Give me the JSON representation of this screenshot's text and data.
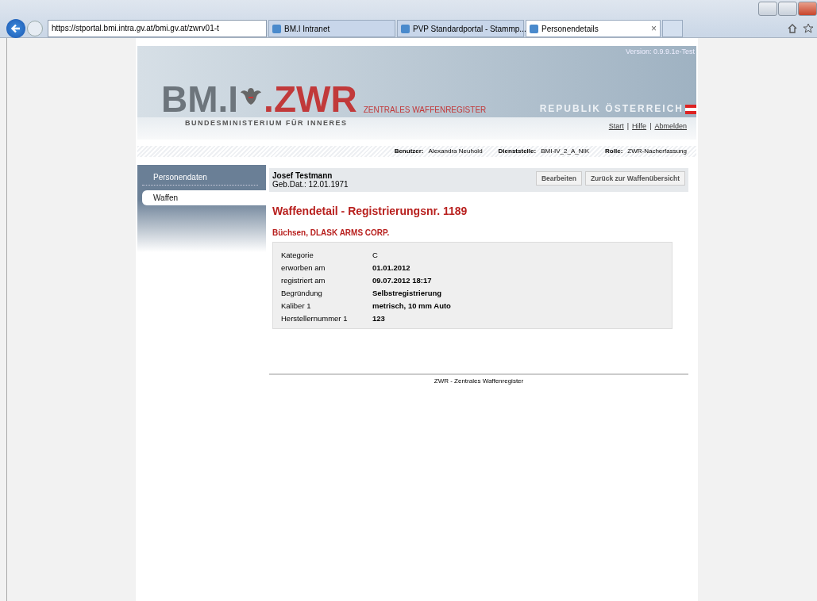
{
  "browser": {
    "address": "https://stportal.bmi.intra.gv.at/bmi.gv.at/zwrv01-t",
    "tabs": [
      {
        "label": "BM.I Intranet",
        "selected": false
      },
      {
        "label": "PVP Standardportal - Stammp...",
        "selected": false
      },
      {
        "label": "Personendetails",
        "selected": true
      }
    ],
    "close_glyph": "×"
  },
  "header": {
    "version": "Version: 0.9.9.1e-Test",
    "logo_left": "BM.I",
    "logo_right": ".ZWR",
    "subtitle": "ZENTRALES WAFFENREGISTER",
    "ministry": "BUNDESMINISTERIUM FÜR INNERES",
    "republic": "REPUBLIK ÖSTERREICH",
    "links": [
      "Start",
      "Hilfe",
      "Abmelden"
    ],
    "link_separator": "|"
  },
  "userbar": [
    {
      "label": "Benutzer:",
      "value": "Alexandra Neuhold"
    },
    {
      "label": "Dienststelle:",
      "value": "BMI-IV_2_A_NIK"
    },
    {
      "label": "Rolle:",
      "value": "ZWR-Nacherfassung"
    }
  ],
  "sidebar": {
    "items": [
      {
        "label": "Personendaten",
        "selected": false
      },
      {
        "label": "Waffen",
        "selected": true
      }
    ]
  },
  "person": {
    "name": "Josef Testmann",
    "birth": "Geb.Dat.: 12.01.1971",
    "buttons": [
      "Bearbeiten",
      "Zurück zur Waffenübersicht"
    ]
  },
  "title": "Waffendetail - Registrierungsnr. 1189",
  "subtitle": "Büchsen, DLASK ARMS CORP.",
  "details": [
    {
      "label": "Kategorie",
      "value": "C",
      "bold": false
    },
    {
      "label": "erworben am",
      "value": "01.01.2012",
      "bold": true
    },
    {
      "label": "registriert am",
      "value": "09.07.2012 18:17",
      "bold": true
    },
    {
      "label": "Begründung",
      "value": "Selbstregistrierung",
      "bold": true
    },
    {
      "label": "Kaliber 1",
      "value": "metrisch, 10 mm Auto",
      "bold": true
    },
    {
      "label": "Herstellernummer 1",
      "value": "123",
      "bold": true
    }
  ],
  "footer": "ZWR - Zentrales Waffenregister"
}
